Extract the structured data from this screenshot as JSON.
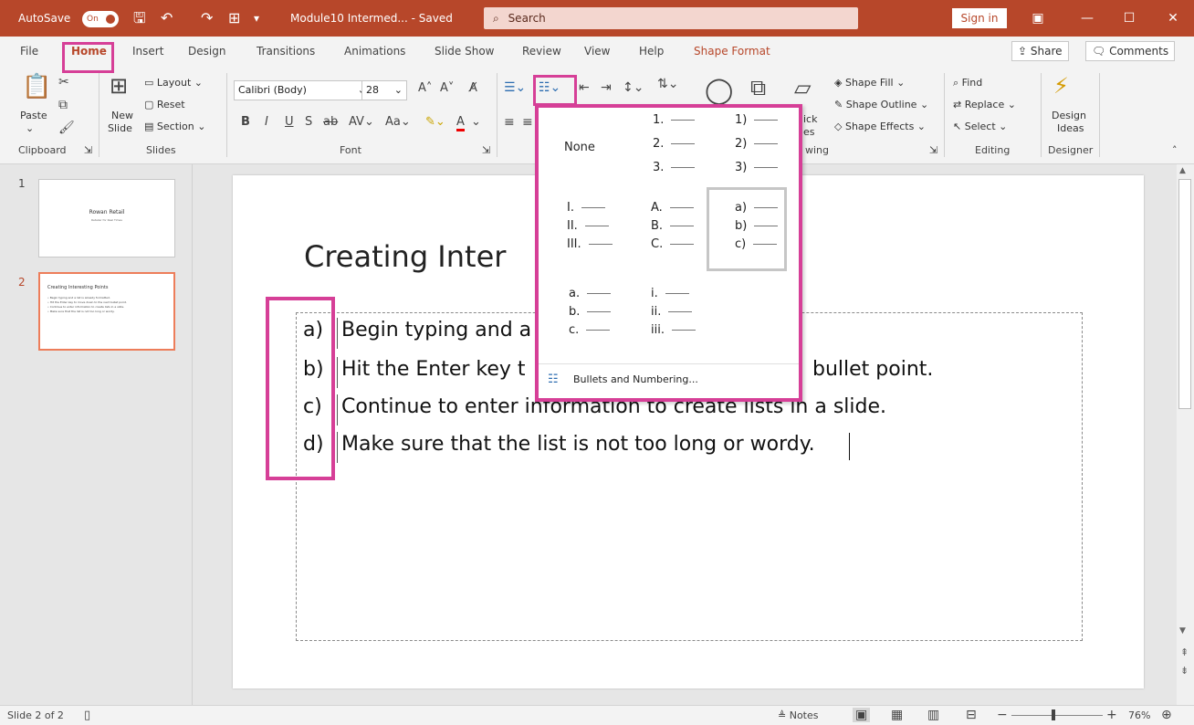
{
  "titlebar": {
    "autosave": "AutoSave",
    "toggle": "On",
    "doc_title": "Module10 Intermed... - Saved",
    "search": "Search",
    "signin": "Sign in"
  },
  "tabs": [
    "File",
    "Home",
    "Insert",
    "Design",
    "Transitions",
    "Animations",
    "Slide Show",
    "Review",
    "View",
    "Help",
    "Shape Format"
  ],
  "tab_buttons": {
    "share": "Share",
    "comments": "Comments"
  },
  "ribbon": {
    "paste": "Paste",
    "new_slide": "New",
    "new_slide2": "Slide",
    "layout": "Layout",
    "reset": "Reset",
    "section": "Section",
    "font_name": "Calibri (Body)",
    "font_size": "28",
    "shape_fill": "Shape Fill",
    "shape_outline": "Shape Outline",
    "shape_effects": "Shape Effects",
    "find": "Find",
    "replace": "Replace",
    "select": "Select",
    "design_ideas": "Design",
    "design_ideas2": "Ideas",
    "quick_partial": "ick",
    "styles_partial": "es",
    "groups": {
      "clipboard": "Clipboard",
      "slides": "Slides",
      "font": "Font",
      "drawing_partial": "wing",
      "editing": "Editing",
      "designer": "Designer"
    }
  },
  "thumbs": {
    "s1_num": "1",
    "s1_title": "Rowan Retail",
    "s1_sub": "Retailer for Real Times",
    "s2_num": "2",
    "s2_title": "Creating Interesting Points",
    "s2_lines": [
      "• Begin typing and a list is already formatted.",
      "• Hit the Enter key to move down to the next bullet point.",
      "• Continue to enter information to create lists in a slide.",
      "• Make sure that the list is not too long or wordy."
    ]
  },
  "slide": {
    "title": "Creating Inter",
    "items": [
      {
        "n": "a)",
        "t": "Begin typing and a"
      },
      {
        "n": "b)",
        "t": "Hit the Enter key t"
      },
      {
        "n": "c)",
        "t": "Continue to enter information to create lists in a slide."
      },
      {
        "n": "d)",
        "t": "Make sure that the list is not too long or wordy."
      }
    ],
    "tail_b": "bullet point."
  },
  "numbering": {
    "none": "None",
    "opt_num_dot": [
      "1.",
      "2.",
      "3."
    ],
    "opt_num_paren": [
      "1)",
      "2)",
      "3)"
    ],
    "opt_roman_upper": [
      "I.",
      "II.",
      "III."
    ],
    "opt_alpha_upper": [
      "A.",
      "B.",
      "C."
    ],
    "opt_alpha_paren": [
      "a)",
      "b)",
      "c)"
    ],
    "opt_alpha_lower": [
      "a.",
      "b.",
      "c."
    ],
    "opt_roman_lower": [
      "i.",
      "ii.",
      "iii."
    ],
    "footer": "Bullets and Numbering..."
  },
  "status": {
    "slide_of": "Slide 2 of 2",
    "notes": "Notes",
    "zoom": "76%"
  }
}
